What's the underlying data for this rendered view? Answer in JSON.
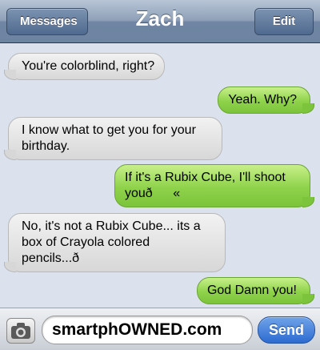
{
  "header": {
    "back_label": "Messages",
    "title": "Zach",
    "edit_label": "Edit"
  },
  "messages": [
    {
      "direction": "incoming",
      "text": "You're colorblind, right?"
    },
    {
      "direction": "outgoing",
      "text": "Yeah. Why?"
    },
    {
      "direction": "incoming",
      "text": "I know what to get you for your birthday."
    },
    {
      "direction": "outgoing",
      "text": "If it's a Rubix Cube, I'll shoot youð«"
    },
    {
      "direction": "incoming",
      "text": "No, it's not a Rubix Cube... its a box of Crayola colored pencils...ð"
    },
    {
      "direction": "outgoing",
      "text": "God Damn you!"
    }
  ],
  "composer": {
    "text_value": "smartphOWNED.com",
    "send_label": "Send",
    "camera_icon": "camera-icon"
  },
  "colors": {
    "incoming_bubble": "#e4e4e4",
    "outgoing_bubble": "#8ed24a",
    "send_button": "#2d6bd1"
  }
}
